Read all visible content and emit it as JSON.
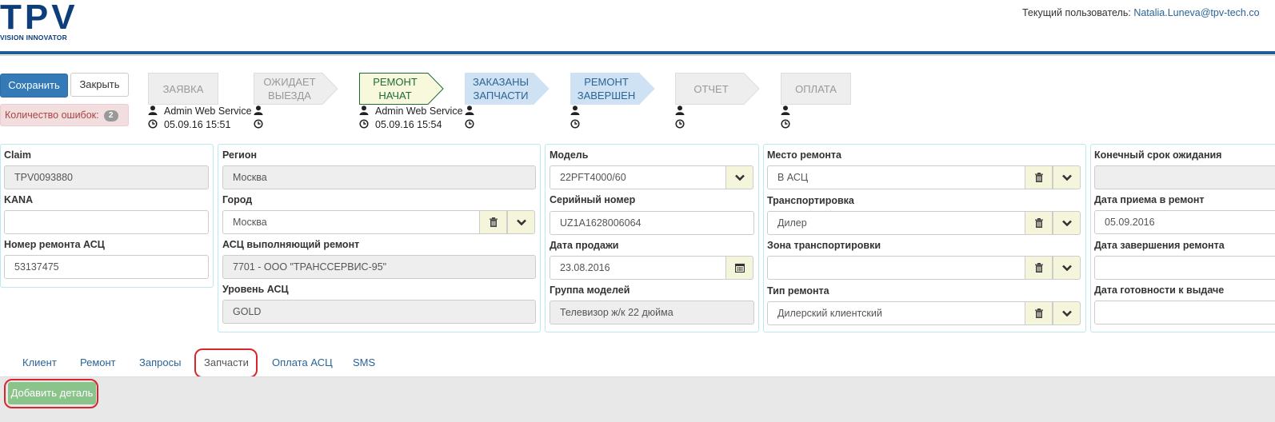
{
  "header": {
    "logo_text": "TPV",
    "logo_sub": "VISION INNOVATOR",
    "user_label": "Текущий пользователь:",
    "user_email": "Natalia.Luneva@tpv-tech.co"
  },
  "toolbar": {
    "save_label": "Сохранить",
    "close_label": "Закрыть",
    "errors_label": "Количество ошибок:",
    "errors_count": "2"
  },
  "steps": [
    {
      "label": "ЗАЯВКА",
      "state": "done",
      "user": "Admin Web Service",
      "time": "05.09.16 15:51"
    },
    {
      "label": "ОЖИДАЕТ ВЫЕЗДА",
      "state": "skipped",
      "user": "",
      "time": ""
    },
    {
      "label": "РЕМОНТ НАЧАТ",
      "state": "current",
      "user": "Admin Web Service",
      "time": "05.09.16 15:54"
    },
    {
      "label": "ЗАКАЗАНЫ ЗАПЧАСТИ",
      "state": "next",
      "user": "",
      "time": ""
    },
    {
      "label": "РЕМОНТ ЗАВЕРШЕН",
      "state": "next",
      "user": "",
      "time": ""
    },
    {
      "label": "ОТЧЕТ",
      "state": "pending",
      "user": "",
      "time": ""
    },
    {
      "label": "ОПЛАТА",
      "state": "pending",
      "user": "",
      "time": ""
    }
  ],
  "form": {
    "claim_label": "Claim",
    "claim_value": "TPV0093880",
    "kana_label": "KANA",
    "kana_value": "",
    "asc_repair_no_label": "Номер ремонта АСЦ",
    "asc_repair_no_value": "53137475",
    "region_label": "Регион",
    "region_value": "Москва",
    "city_label": "Город",
    "city_value": "Москва",
    "asc_label": "АСЦ выполняющий ремонт",
    "asc_value": "7701 - ООО \"ТРАНССЕРВИС-95\"",
    "asc_level_label": "Уровень АСЦ",
    "asc_level_value": "GOLD",
    "model_label": "Модель",
    "model_value": "22PFT4000/60",
    "serial_label": "Серийный номер",
    "serial_value": "UZ1A1628006064",
    "sale_date_label": "Дата продажи",
    "sale_date_value": "23.08.2016",
    "model_group_label": "Группа моделей",
    "model_group_value": "Телевизор ж/к 22 дюйма",
    "repair_place_label": "Место ремонта",
    "repair_place_value": "В АСЦ",
    "transport_label": "Транспортировка",
    "transport_value": "Дилер",
    "transport_zone_label": "Зона транспортировки",
    "transport_zone_value": "",
    "repair_type_label": "Тип ремонта",
    "repair_type_value": "Дилерский клиентский",
    "deadline_label": "Конечный срок ожидания",
    "deadline_value": "",
    "accept_date_label": "Дата приема в ремонт",
    "accept_date_value": "05.09.2016",
    "finish_date_label": "Дата завершения ремонта",
    "finish_date_value": "",
    "ready_date_label": "Дата готовности к выдаче",
    "ready_date_value": ""
  },
  "tabs": [
    "Клиент",
    "Ремонт",
    "Запросы",
    "Запчасти",
    "Оплата АСЦ",
    "SMS"
  ],
  "active_tab": "Запчасти",
  "parts": {
    "add_label": "Добавить деталь"
  },
  "colors": {
    "primary": "#337ab7",
    "brand": "#0e3e7a",
    "highlight": "#d9262a",
    "step_next": "#cfe2f3",
    "step_current": "#f8f8dc"
  }
}
